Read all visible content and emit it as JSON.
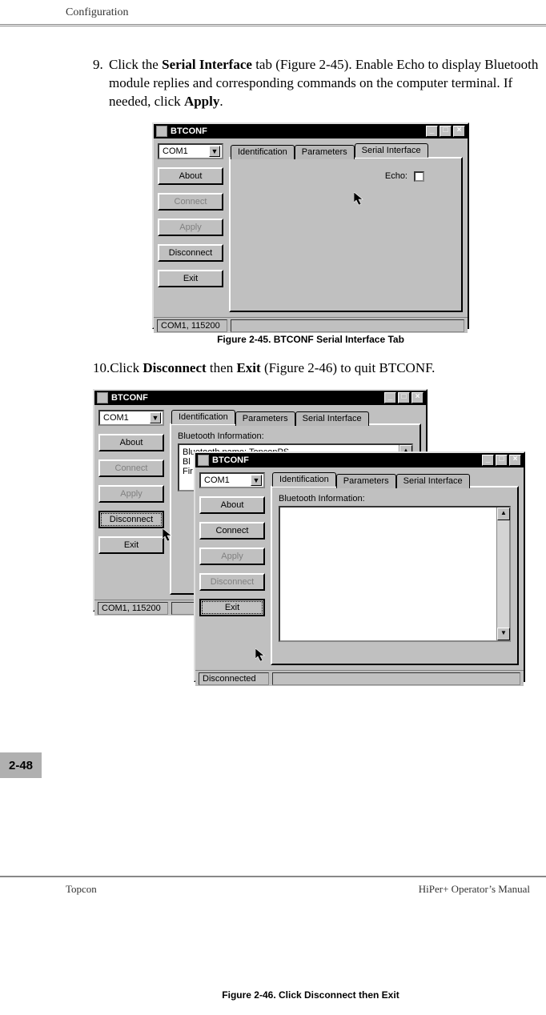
{
  "header": {
    "section": "Configuration"
  },
  "steps": {
    "s9": {
      "num": "9.",
      "pre": "Click the ",
      "b1": "Serial Interface",
      "mid": " tab (Figure 2-45). Enable Echo to display Bluetooth module replies and corresponding commands on the computer terminal. If needed, click ",
      "b2": "Apply",
      "post": "."
    },
    "s10": {
      "num": "10.",
      "pre": "Click ",
      "b1": "Disconnect",
      "mid": " then ",
      "b2": "Exit",
      "post": " (Figure 2-46) to quit BTCONF."
    }
  },
  "fig1": {
    "caption": "Figure 2-45. BTCONF Serial Interface Tab",
    "title": "BTCONF",
    "com": "COM1",
    "side": {
      "about": "About",
      "connect": "Connect",
      "apply": "Apply",
      "disconnect": "Disconnect",
      "exit": "Exit"
    },
    "tabs": {
      "id": "Identification",
      "params": "Parameters",
      "serial": "Serial Interface"
    },
    "echo_label": "Echo:",
    "status": "COM1, 115200"
  },
  "fig2": {
    "caption": "Figure 2-46. Click Disconnect then Exit",
    "back": {
      "title": "BTCONF",
      "com": "COM1",
      "side": {
        "about": "About",
        "connect": "Connect",
        "apply": "Apply",
        "disconnect": "Disconnect",
        "exit": "Exit"
      },
      "tabs": {
        "id": "Identification",
        "params": "Parameters",
        "serial": "Serial Interface"
      },
      "group_label": "Bluetooth Information:",
      "info_line1": "Bluetooth name: TopconPS",
      "info_line2": "Bl",
      "info_line3": "Fir",
      "status": "COM1, 115200"
    },
    "front": {
      "title": "BTCONF",
      "com": "COM1",
      "side": {
        "about": "About",
        "connect": "Connect",
        "apply": "Apply",
        "disconnect": "Disconnect",
        "exit": "Exit"
      },
      "tabs": {
        "id": "Identification",
        "params": "Parameters",
        "serial": "Serial Interface"
      },
      "group_label": "Bluetooth Information:",
      "status": "Disconnected"
    }
  },
  "page_num": "2-48",
  "footer": {
    "left": "Topcon",
    "right": "HiPer+ Operator’s Manual"
  },
  "sys": {
    "min": "_",
    "max": "□",
    "close": "×",
    "down": "▼",
    "up": "▲"
  }
}
